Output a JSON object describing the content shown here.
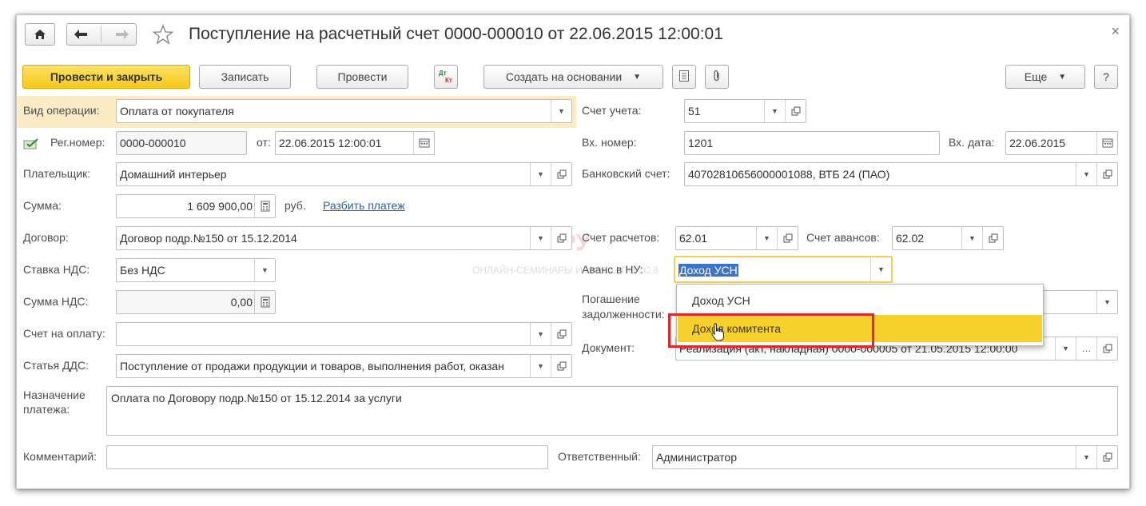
{
  "window": {
    "title": "Поступление на расчетный счет 0000-000010 от 22.06.2015 12:00:01",
    "close_symbol": "×"
  },
  "toolbar": {
    "post_close": "Провести и закрыть",
    "save": "Записать",
    "post": "Провести",
    "dt_kt": "ДтКт",
    "create_based": "Создать на основании",
    "more": "Еще",
    "help": "?"
  },
  "left": {
    "op_type_label": "Вид операции:",
    "op_type_value": "Оплата от покупателя",
    "reg_label": "Рег.номер:",
    "reg_value": "0000-000010",
    "from_label": "от:",
    "date_value": "22.06.2015 12:00:01",
    "payer_label": "Плательщик:",
    "payer_value": "Домашний интерьер",
    "sum_label": "Сумма:",
    "sum_value": "1 609 900,00",
    "currency": "руб.",
    "split_link": "Разбить платеж",
    "contract_label": "Договор:",
    "contract_value": "Договор подр.№150 от 15.12.2014",
    "vat_rate_label": "Ставка НДС:",
    "vat_rate_value": "Без НДС",
    "vat_sum_label": "Сумма НДС:",
    "vat_sum_value": "0,00",
    "invoice_label": "Счет на оплату:",
    "invoice_value": "",
    "cash_item_label": "Статья ДДС:",
    "cash_item_value": "Поступление от продажи продукции и товаров, выполнения работ, оказан",
    "purpose_label": "Назначение платежа:",
    "purpose_value": "Оплата по Договору подр.№150 от 15.12.2014 за услуги",
    "comment_label": "Комментарий:",
    "comment_value": ""
  },
  "right": {
    "account_label": "Счет учета:",
    "account_value": "51",
    "in_num_label": "Вх. номер:",
    "in_num_value": "1201",
    "in_date_label": "Вх. дата:",
    "in_date_value": "22.06.2015",
    "bank_label": "Банковский счет:",
    "bank_value": "40702810656000001088, ВТБ 24 (ПАО)",
    "settle_label": "Счет расчетов:",
    "settle_value": "62.01",
    "advance_label": "Счет авансов:",
    "advance_value": "62.02",
    "advance_nu_label": "Аванс в НУ:",
    "advance_nu_value": "Доход УСН",
    "repay_label": "Погашение задолженности:",
    "repay_value": "",
    "doc_label": "Документ:",
    "doc_value": "Реализация (акт, накладная) 0000-000005 от 21.05.2015 12:00:00",
    "responsible_label": "Ответственный:",
    "responsible_value": "Администратор"
  },
  "dropdown": {
    "options": [
      "Доход УСН",
      "Доход комитента"
    ],
    "highlighted": "Доход комитента"
  },
  "watermark": {
    "main": "ПРОФБУХ8.РУ",
    "sub": "ОНЛАЙН-СЕМИНАРЫ И КУРСЫ ПО 1С:8"
  },
  "colors": {
    "accent": "#f5c81a",
    "highlight_row": "#fbecc6",
    "link": "#2a5fb0",
    "red_frame": "#e0262a",
    "selection": "#3a73c8"
  }
}
